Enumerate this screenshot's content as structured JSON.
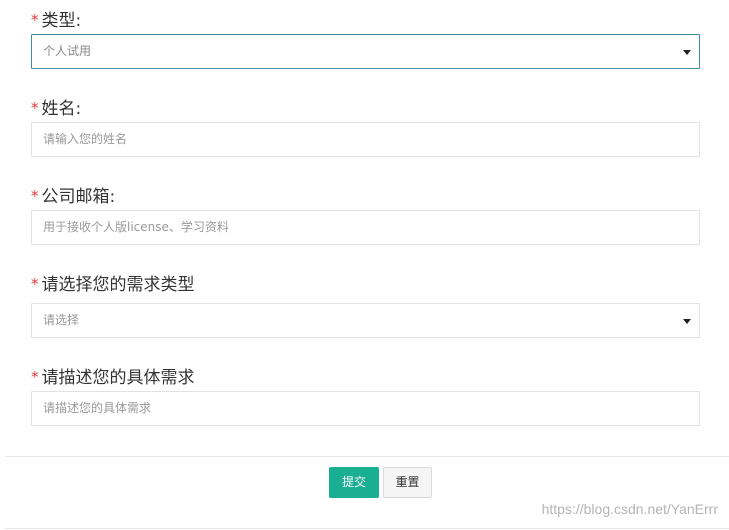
{
  "required_mark": "*",
  "form": {
    "type": {
      "label": "类型:",
      "value": "个人试用"
    },
    "name": {
      "label": "姓名:",
      "placeholder": "请输入您的姓名"
    },
    "email": {
      "label": "公司邮箱:",
      "placeholder": "用于接收个人版license、学习资料"
    },
    "demand_type": {
      "label": "请选择您的需求类型",
      "value": "请选择"
    },
    "demand_desc": {
      "label": "请描述您的具体需求",
      "placeholder": "请描述您的具体需求"
    }
  },
  "buttons": {
    "submit_label": "提交",
    "reset_label": "重置"
  },
  "watermark": "https://blog.csdn.net/YanErrr",
  "colors": {
    "required": "#e4393c",
    "submit_bg": "#1aae93",
    "focus_border": "#3f8ca1"
  }
}
